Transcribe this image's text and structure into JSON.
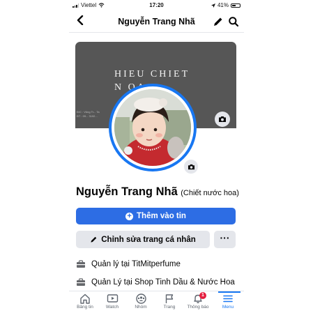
{
  "status_bar": {
    "carrier": "Viettel",
    "time": "17:20",
    "battery": "41%"
  },
  "header": {
    "title": "Nguyễn Trang Nhã",
    "back_icon": "chevron-left-icon",
    "edit_icon": "pencil-icon",
    "search_icon": "search-icon"
  },
  "cover": {
    "text_line1": "HIEU CHIET",
    "text_line2": "N           OA",
    "small_text_1": "Đ/C : Vũng Tr... Ta",
    "small_text_2": "ĐT : 09... 3192..."
  },
  "profile": {
    "name": "Nguyễn Trang Nhã",
    "alternate_name": "(Chiết nước hoa)"
  },
  "buttons": {
    "add_story": "Thêm vào tin",
    "edit_profile": "Chỉnh sửa trang cá nhân",
    "more": "···"
  },
  "info": [
    {
      "prefix": "Quản lý tại ",
      "place": "TitMitperfume"
    },
    {
      "prefix": "Quản Lý tại ",
      "place": "Shop Tinh Dầu & Nước Hoa"
    }
  ],
  "tabs": [
    {
      "label": "Bảng tin",
      "icon": "home-icon"
    },
    {
      "label": "Watch",
      "icon": "watch-icon"
    },
    {
      "label": "Nhóm",
      "icon": "groups-icon"
    },
    {
      "label": "Trang",
      "icon": "flag-icon"
    },
    {
      "label": "Thông báo",
      "icon": "bell-icon",
      "badge": "1"
    },
    {
      "label": "Menu",
      "icon": "menu-icon",
      "active": true
    }
  ],
  "colors": {
    "accent": "#1877f2",
    "primary_button": "#2d6de4",
    "secondary_button": "#e4e6eb",
    "badge": "#e41e3f"
  }
}
